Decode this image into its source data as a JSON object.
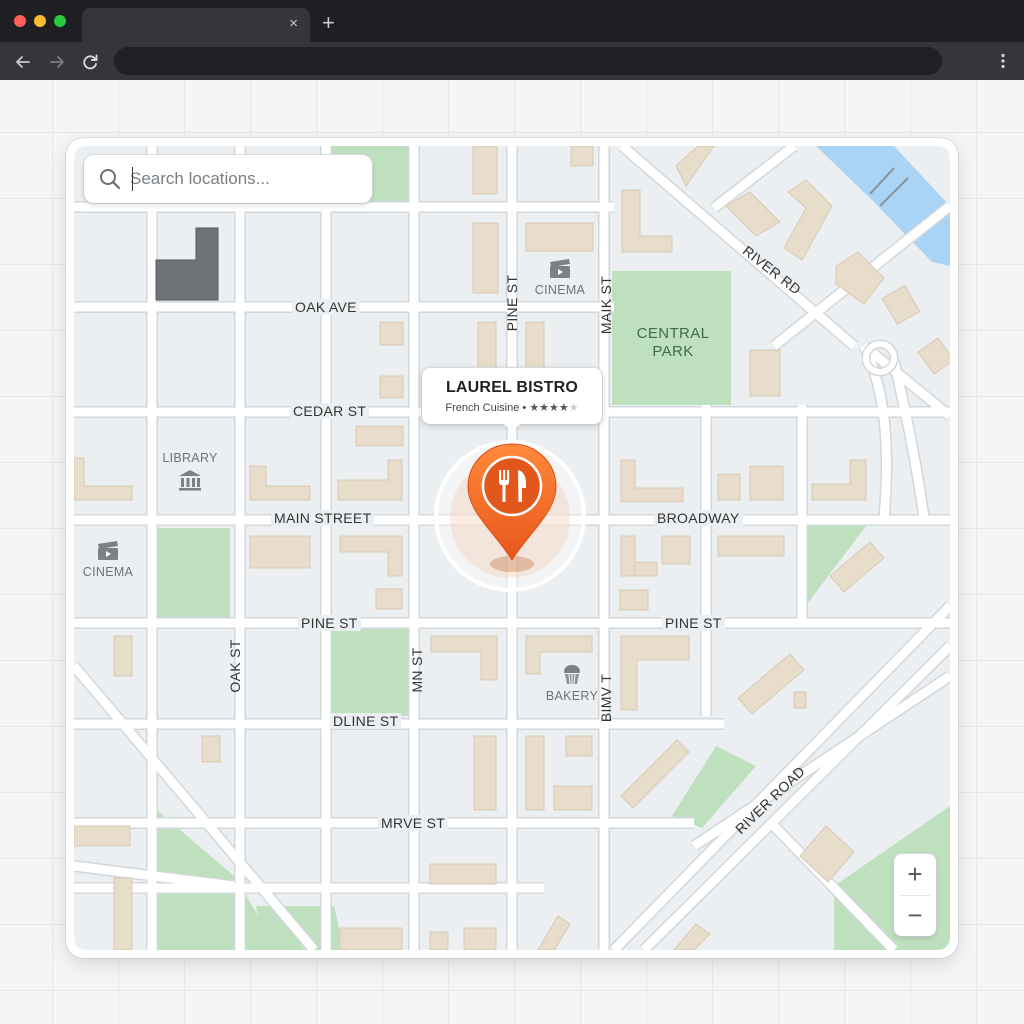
{
  "browser": {
    "tab_close_glyph": "×",
    "new_tab_glyph": "+"
  },
  "search": {
    "placeholder": "Search locations...",
    "icon": "search-icon"
  },
  "map": {
    "streets": {
      "oak_ave": "OAK AVE",
      "cedar_st": "CEDAR ST",
      "main_street": "MAIN STREET",
      "broadway": "BROADWAY",
      "pine_st_left": "PINE ST",
      "pine_st_right": "PINE ST",
      "dline_st": "DLINE ST",
      "mrve_st": "MRVE ST",
      "pine_st_vertical": "PINE ST",
      "maik_st": "MAIK ST",
      "oak_st": "OAK ST",
      "mn_st": "MN ST",
      "bimv_t": "BIMV T",
      "river_rd": "RIVER RD",
      "river_road": "RIVER ROAD"
    },
    "park": {
      "line1": "CENTRAL",
      "line2": "PARK"
    },
    "pois": {
      "cinema_top": {
        "label": "CINEMA",
        "icon": "clapperboard-icon"
      },
      "cinema_left": {
        "label": "CINEMA",
        "icon": "clapperboard-icon"
      },
      "library": {
        "label": "LIBRARY",
        "icon": "museum-icon"
      },
      "bakery": {
        "label": "BAKERY",
        "icon": "cupcake-icon"
      }
    },
    "marker": {
      "icon": "fork-knife-icon",
      "color": "#f26a21"
    },
    "info_card": {
      "title": "LAUREL BISTRO",
      "category": "French Cuisine",
      "separator": "•",
      "rating": 4,
      "stars_filled": "★★★★",
      "stars_empty": "★"
    },
    "zoom": {
      "in": "+",
      "out": "−"
    }
  },
  "colors": {
    "map_bg": "#eceff1",
    "road": "#ffffff",
    "road_edge": "#d2d7db",
    "building": "#e8dcca",
    "park": "#bfe0bf",
    "water": "#a9d4f5",
    "dark_building": "#6f7378",
    "accent": "#f26a21"
  }
}
